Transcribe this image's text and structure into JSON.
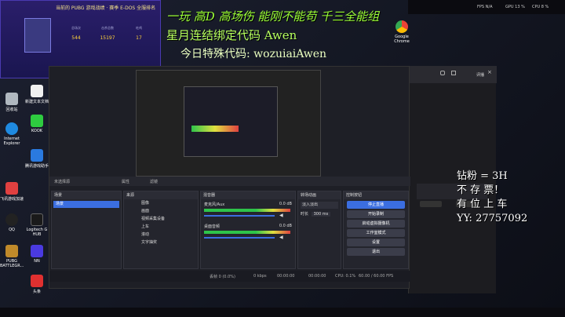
{
  "banner": {
    "header": "当前的 PUBG 游戏战绩 · 赛季 E-DOS 全服排名",
    "stats": [
      {
        "label": "总场次",
        "value": "544"
      },
      {
        "label": "击杀总数",
        "value": "15197"
      },
      {
        "label": "吃鸡",
        "value": "17"
      }
    ],
    "button": "查看成就"
  },
  "overlay": {
    "line1": "一玩 高D 高场伤 能刚不能苟 千三全能组",
    "line2": "星月连结绑定代码 Awen",
    "line3": "今日特殊代码: wozuiaiAwen",
    "right_lines": [
      "钻粉 = 3H",
      "不 存 票！",
      "有 位 上 车",
      "YY: 27757092"
    ]
  },
  "topbar": {
    "fps": "FPS N/A",
    "gpu": "GPU 13 %",
    "cpu": "CPU 8 %"
  },
  "desktop_icons": [
    {
      "label": "新建文本文档"
    },
    {
      "label": "回收站"
    },
    {
      "label": "Internet Explorer"
    },
    {
      "label": "KOOK"
    },
    {
      "label": "腾讯游戏助手"
    },
    {
      "label": "飞讯游戏加速"
    },
    {
      "label": "QQ"
    },
    {
      "label": "Logitech G HUB"
    },
    {
      "label": "PUBG BATTLEGR..."
    },
    {
      "label": "NN"
    },
    {
      "label": "头条"
    }
  ],
  "chrome": {
    "label": "Google Chrome"
  },
  "obs": {
    "subbar": {
      "left": "未选择源",
      "props": "属性",
      "filters": "滤镜"
    },
    "docks": {
      "scenes": {
        "title": "场景",
        "items": [
          "场景"
        ]
      },
      "sources": {
        "title": "来源",
        "items": [
          "图像",
          "画面",
          "视频采集设备",
          "上车",
          "滚动",
          "文字抽奖"
        ]
      },
      "mixer": {
        "title": "混音器",
        "tracks": [
          {
            "name": "麦克风/Aux",
            "db": "0.0 dB"
          },
          {
            "name": "桌面音频",
            "db": "0.0 dB"
          }
        ]
      },
      "transitions": {
        "title": "转场动画",
        "type": "淡入淡出",
        "duration_label": "时长",
        "duration": "300 ms"
      },
      "controls": {
        "title": "控制按钮",
        "buttons": [
          "停止直播",
          "开始录制",
          "启动虚拟摄像机",
          "工作室模式",
          "设置",
          "退出"
        ]
      }
    },
    "status": {
      "dropped": "丢帧 0 (0.0%)",
      "kbps": "0 kbps",
      "time1": "00:00:00",
      "time2": "00:00:00",
      "cpu": "CPU: 0.1%",
      "fps": "60.00 / 60.00 FPS"
    }
  },
  "browser": {
    "tab_label": "评播"
  },
  "colors": {
    "accent": "#3b6ee0",
    "overlay_green": "#9bff36",
    "banner_gold": "#ffd23a"
  }
}
